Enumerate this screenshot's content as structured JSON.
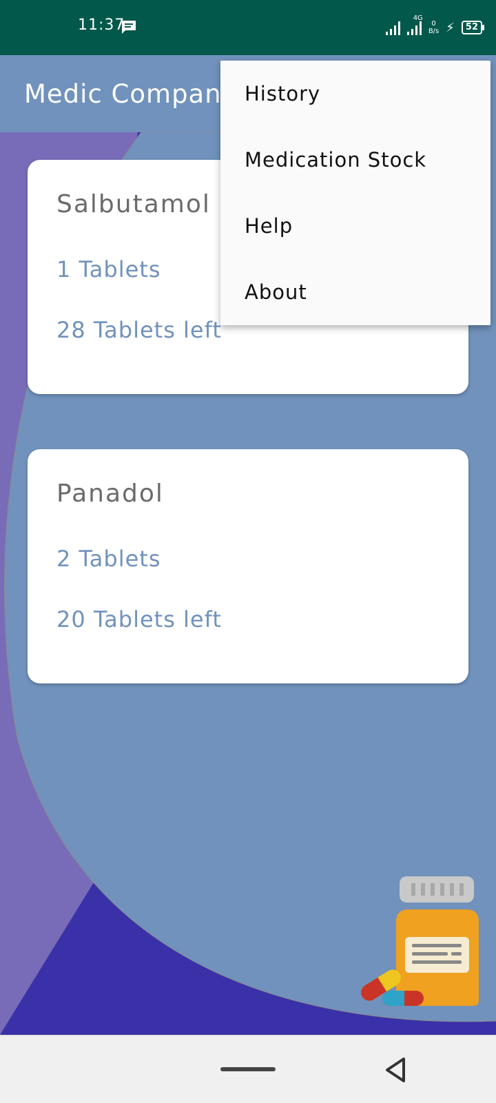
{
  "status_bar": {
    "time": "11:37",
    "network_label": "4G",
    "data_rate_value": "0",
    "data_rate_unit": "B/s",
    "battery": "52"
  },
  "app_bar": {
    "title": "Medic Companion"
  },
  "medications": [
    {
      "name": "Salbutamol",
      "dose": "1 Tablets",
      "remaining": "28 Tablets left"
    },
    {
      "name": "Panadol",
      "dose": "2 Tablets",
      "remaining": "20 Tablets left"
    }
  ],
  "menu": {
    "items": [
      {
        "label": "History"
      },
      {
        "label": "Medication Stock"
      },
      {
        "label": "Help"
      },
      {
        "label": "About"
      }
    ]
  },
  "icons": {
    "message": "message-icon",
    "signal": "signal-icon",
    "charging": "charging-icon",
    "battery": "battery-icon",
    "pill_bottle": "pill-bottle-icon",
    "back": "back-icon"
  },
  "colors": {
    "status_bar": "#02584a",
    "app_bar": "#7092bc",
    "accent_text": "#7092bc",
    "background_dark": "#3a31a9",
    "background_purple": "#786cb8"
  }
}
